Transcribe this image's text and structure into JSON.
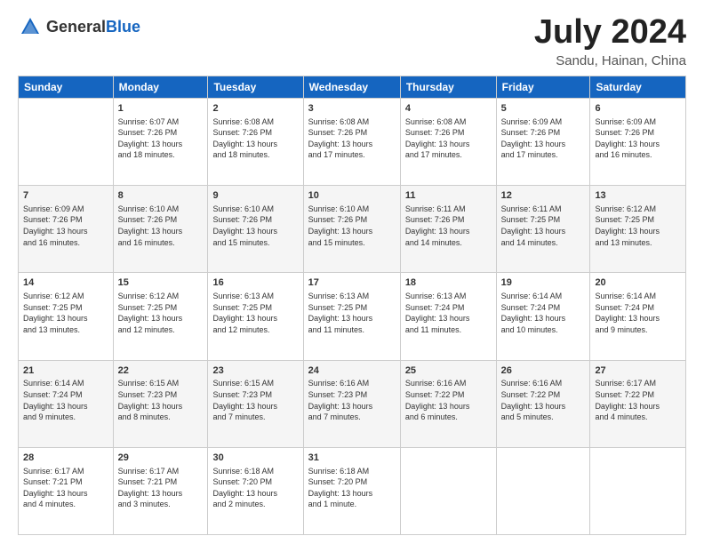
{
  "logo": {
    "general": "General",
    "blue": "Blue"
  },
  "header": {
    "title": "July 2024",
    "location": "Sandu, Hainan, China"
  },
  "days_header": [
    "Sunday",
    "Monday",
    "Tuesday",
    "Wednesday",
    "Thursday",
    "Friday",
    "Saturday"
  ],
  "weeks": [
    [
      {
        "num": "",
        "info": ""
      },
      {
        "num": "1",
        "info": "Sunrise: 6:07 AM\nSunset: 7:26 PM\nDaylight: 13 hours\nand 18 minutes."
      },
      {
        "num": "2",
        "info": "Sunrise: 6:08 AM\nSunset: 7:26 PM\nDaylight: 13 hours\nand 18 minutes."
      },
      {
        "num": "3",
        "info": "Sunrise: 6:08 AM\nSunset: 7:26 PM\nDaylight: 13 hours\nand 17 minutes."
      },
      {
        "num": "4",
        "info": "Sunrise: 6:08 AM\nSunset: 7:26 PM\nDaylight: 13 hours\nand 17 minutes."
      },
      {
        "num": "5",
        "info": "Sunrise: 6:09 AM\nSunset: 7:26 PM\nDaylight: 13 hours\nand 17 minutes."
      },
      {
        "num": "6",
        "info": "Sunrise: 6:09 AM\nSunset: 7:26 PM\nDaylight: 13 hours\nand 16 minutes."
      }
    ],
    [
      {
        "num": "7",
        "info": "Sunrise: 6:09 AM\nSunset: 7:26 PM\nDaylight: 13 hours\nand 16 minutes."
      },
      {
        "num": "8",
        "info": "Sunrise: 6:10 AM\nSunset: 7:26 PM\nDaylight: 13 hours\nand 16 minutes."
      },
      {
        "num": "9",
        "info": "Sunrise: 6:10 AM\nSunset: 7:26 PM\nDaylight: 13 hours\nand 15 minutes."
      },
      {
        "num": "10",
        "info": "Sunrise: 6:10 AM\nSunset: 7:26 PM\nDaylight: 13 hours\nand 15 minutes."
      },
      {
        "num": "11",
        "info": "Sunrise: 6:11 AM\nSunset: 7:26 PM\nDaylight: 13 hours\nand 14 minutes."
      },
      {
        "num": "12",
        "info": "Sunrise: 6:11 AM\nSunset: 7:25 PM\nDaylight: 13 hours\nand 14 minutes."
      },
      {
        "num": "13",
        "info": "Sunrise: 6:12 AM\nSunset: 7:25 PM\nDaylight: 13 hours\nand 13 minutes."
      }
    ],
    [
      {
        "num": "14",
        "info": "Sunrise: 6:12 AM\nSunset: 7:25 PM\nDaylight: 13 hours\nand 13 minutes."
      },
      {
        "num": "15",
        "info": "Sunrise: 6:12 AM\nSunset: 7:25 PM\nDaylight: 13 hours\nand 12 minutes."
      },
      {
        "num": "16",
        "info": "Sunrise: 6:13 AM\nSunset: 7:25 PM\nDaylight: 13 hours\nand 12 minutes."
      },
      {
        "num": "17",
        "info": "Sunrise: 6:13 AM\nSunset: 7:25 PM\nDaylight: 13 hours\nand 11 minutes."
      },
      {
        "num": "18",
        "info": "Sunrise: 6:13 AM\nSunset: 7:24 PM\nDaylight: 13 hours\nand 11 minutes."
      },
      {
        "num": "19",
        "info": "Sunrise: 6:14 AM\nSunset: 7:24 PM\nDaylight: 13 hours\nand 10 minutes."
      },
      {
        "num": "20",
        "info": "Sunrise: 6:14 AM\nSunset: 7:24 PM\nDaylight: 13 hours\nand 9 minutes."
      }
    ],
    [
      {
        "num": "21",
        "info": "Sunrise: 6:14 AM\nSunset: 7:24 PM\nDaylight: 13 hours\nand 9 minutes."
      },
      {
        "num": "22",
        "info": "Sunrise: 6:15 AM\nSunset: 7:23 PM\nDaylight: 13 hours\nand 8 minutes."
      },
      {
        "num": "23",
        "info": "Sunrise: 6:15 AM\nSunset: 7:23 PM\nDaylight: 13 hours\nand 7 minutes."
      },
      {
        "num": "24",
        "info": "Sunrise: 6:16 AM\nSunset: 7:23 PM\nDaylight: 13 hours\nand 7 minutes."
      },
      {
        "num": "25",
        "info": "Sunrise: 6:16 AM\nSunset: 7:22 PM\nDaylight: 13 hours\nand 6 minutes."
      },
      {
        "num": "26",
        "info": "Sunrise: 6:16 AM\nSunset: 7:22 PM\nDaylight: 13 hours\nand 5 minutes."
      },
      {
        "num": "27",
        "info": "Sunrise: 6:17 AM\nSunset: 7:22 PM\nDaylight: 13 hours\nand 4 minutes."
      }
    ],
    [
      {
        "num": "28",
        "info": "Sunrise: 6:17 AM\nSunset: 7:21 PM\nDaylight: 13 hours\nand 4 minutes."
      },
      {
        "num": "29",
        "info": "Sunrise: 6:17 AM\nSunset: 7:21 PM\nDaylight: 13 hours\nand 3 minutes."
      },
      {
        "num": "30",
        "info": "Sunrise: 6:18 AM\nSunset: 7:20 PM\nDaylight: 13 hours\nand 2 minutes."
      },
      {
        "num": "31",
        "info": "Sunrise: 6:18 AM\nSunset: 7:20 PM\nDaylight: 13 hours\nand 1 minute."
      },
      {
        "num": "",
        "info": ""
      },
      {
        "num": "",
        "info": ""
      },
      {
        "num": "",
        "info": ""
      }
    ]
  ]
}
